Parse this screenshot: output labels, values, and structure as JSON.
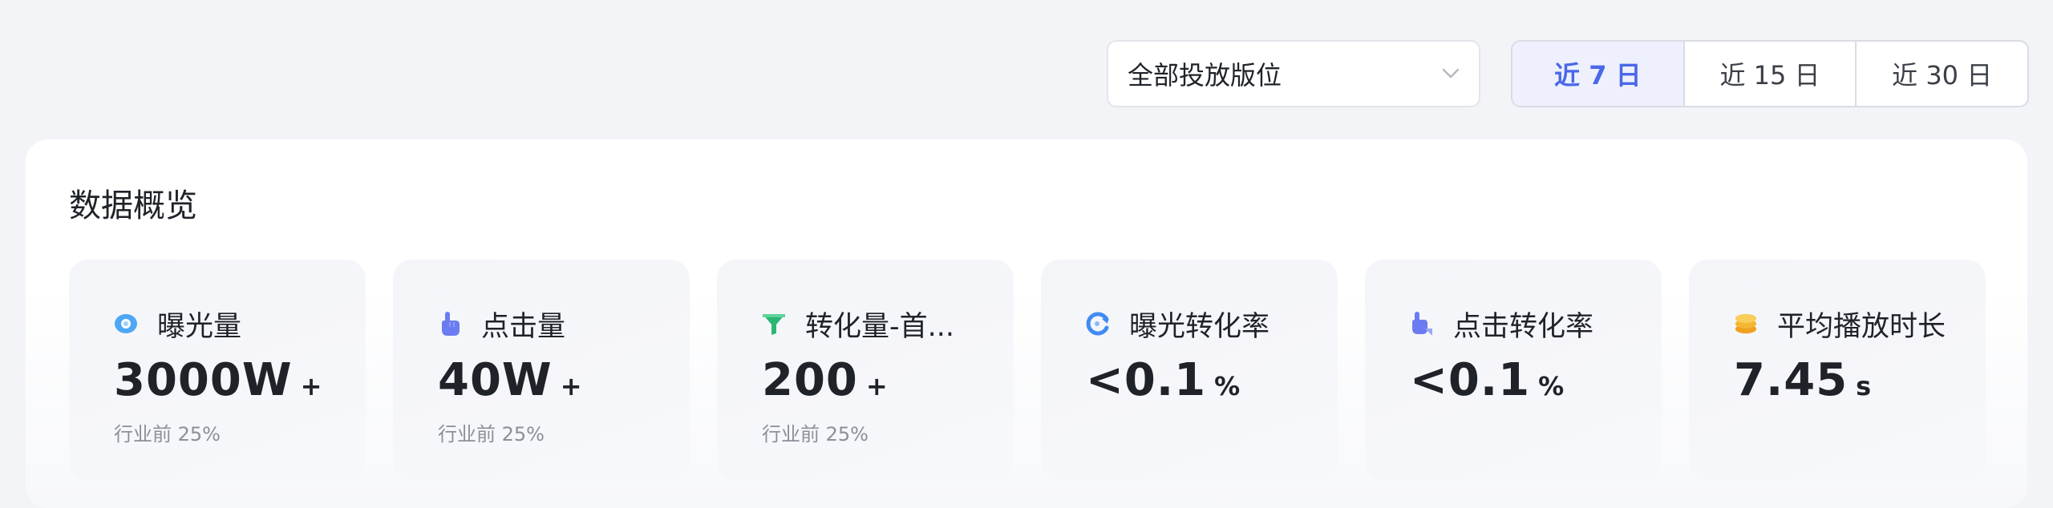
{
  "filter": {
    "placement_select_value": "全部投放版位",
    "ranges": [
      "近 7 日",
      "近 15 日",
      "近 30 日"
    ],
    "active_range_index": 0
  },
  "overview": {
    "title": "数据概览",
    "metrics": [
      {
        "icon": "eye-icon",
        "label": "曝光量",
        "value": "3000W",
        "suffix": "+",
        "sub": "行业前 25%",
        "color": "#4ea7f5"
      },
      {
        "icon": "click-hand-icon",
        "label": "点击量",
        "value": "40W",
        "suffix": "+",
        "sub": "行业前 25%",
        "color": "#6b7cf0"
      },
      {
        "icon": "funnel-icon",
        "label": "转化量-首...",
        "value": "200",
        "suffix": "+",
        "sub": "行业前 25%",
        "color": "#2bb673"
      },
      {
        "icon": "rate-refresh-icon",
        "label": "曝光转化率",
        "value": "<0.1",
        "suffix": "%",
        "sub": "",
        "color": "#3f8cf2"
      },
      {
        "icon": "click-rate-icon",
        "label": "点击转化率",
        "value": "<0.1",
        "suffix": "%",
        "sub": "",
        "color": "#6b7cf0"
      },
      {
        "icon": "coins-icon",
        "label": "平均播放时长",
        "value": "7.45",
        "suffix": "s",
        "sub": "",
        "color": "#f5b731"
      }
    ]
  }
}
